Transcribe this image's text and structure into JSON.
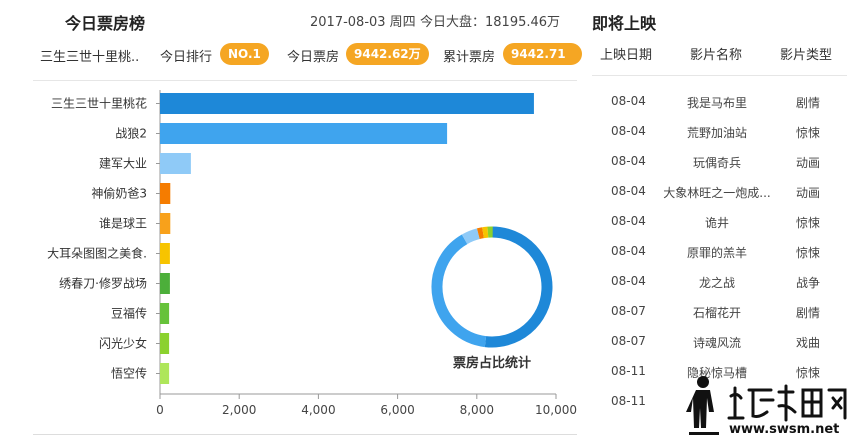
{
  "left": {
    "title": "今日票房榜",
    "date": "2017-08-03 周四",
    "dapan": "今日大盘：18195.46万",
    "stats": {
      "movie": "三生三世十里桃..",
      "rank_label": "今日排行",
      "rank_value": "NO.1",
      "today_label": "今日票房",
      "today_value": "9442.62万",
      "total_label": "累计票房",
      "total_value": "9442.71万"
    }
  },
  "chart_data": {
    "type": "bar",
    "orientation": "horizontal",
    "categories": [
      "三生三世十里桃花",
      "战狼2",
      "建军大业",
      "神偷奶爸3",
      "谁是球王",
      "大耳朵图图之美食.",
      "绣春刀·修罗战场",
      "豆福传",
      "闪光少女",
      "悟空传"
    ],
    "values": [
      9442.62,
      7250,
      780,
      260,
      260,
      250,
      250,
      230,
      230,
      230
    ],
    "colors": [
      "#1e88d8",
      "#3fa4ee",
      "#8fcaf7",
      "#f57c00",
      "#f8a11b",
      "#f7c400",
      "#4caf3a",
      "#66c23a",
      "#8bd12e",
      "#aee65a"
    ],
    "xticks": [
      0,
      2000,
      4000,
      6000,
      8000,
      10000
    ],
    "xtick_labels": [
      "0",
      "2,000",
      "4,000",
      "6,000",
      "8,000",
      "10,000"
    ],
    "xlim": [
      0,
      10000
    ]
  },
  "donut": {
    "label": "票房占比统计",
    "shares": [
      0.519,
      0.398,
      0.043,
      0.014,
      0.014,
      0.014
    ],
    "colors": [
      "#1e88d8",
      "#3fa4ee",
      "#8fcaf7",
      "#f57c00",
      "#f7c400",
      "#8bd12e"
    ]
  },
  "right": {
    "title": "即将上映",
    "headers": [
      "上映日期",
      "影片名称",
      "影片类型"
    ],
    "rows": [
      {
        "date": "08-04",
        "name": "我是马布里",
        "type": "剧情"
      },
      {
        "date": "08-04",
        "name": "荒野加油站",
        "type": "惊悚"
      },
      {
        "date": "08-04",
        "name": "玩偶奇兵",
        "type": "动画"
      },
      {
        "date": "08-04",
        "name": "大象林旺之一炮成...",
        "type": "动画"
      },
      {
        "date": "08-04",
        "name": "诡井",
        "type": "惊悚"
      },
      {
        "date": "08-04",
        "name": "原罪的羔羊",
        "type": "惊悚"
      },
      {
        "date": "08-04",
        "name": "龙之战",
        "type": "战争"
      },
      {
        "date": "08-07",
        "name": "石榴花开",
        "type": "剧情"
      },
      {
        "date": "08-07",
        "name": "诗魂风流",
        "type": "戏曲"
      },
      {
        "date": "08-11",
        "name": "隐秘惊马槽",
        "type": "惊悚"
      },
      {
        "date": "08-11",
        "name": "",
        "type": ""
      }
    ]
  },
  "watermark": {
    "name": "汕尾市民网",
    "url": "www.swsm.net"
  }
}
